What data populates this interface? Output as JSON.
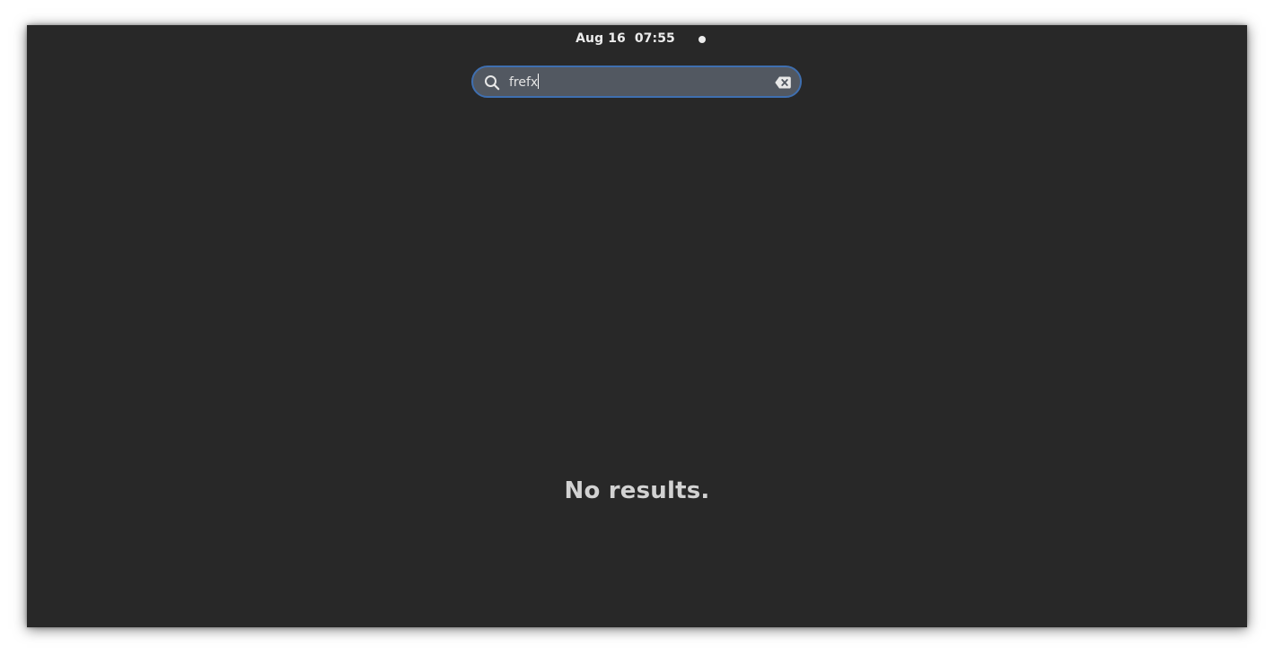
{
  "topbar": {
    "date": "Aug 16",
    "time": "07:55",
    "notification_icon": "dot-icon"
  },
  "search": {
    "value": "frefx",
    "icon": "search-icon",
    "clear_icon": "backspace-clear-icon"
  },
  "results": {
    "message": "No results."
  },
  "colors": {
    "background": "#282828",
    "entry_background": "#525861",
    "entry_focus_border": "#3f6fb0",
    "text": "#ececec"
  }
}
